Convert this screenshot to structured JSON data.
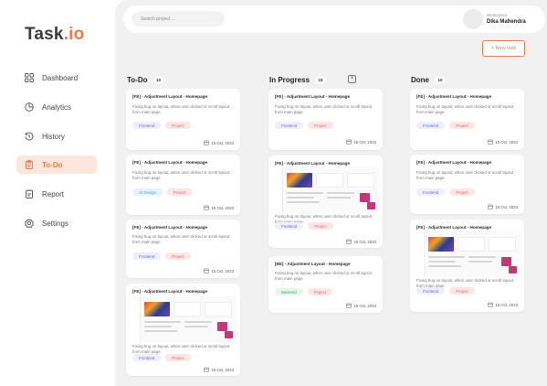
{
  "app": {
    "logo_main": "Task",
    "logo_accent": ".io"
  },
  "sidebar": {
    "items": [
      {
        "label": "Dashboard",
        "icon": "grid-icon",
        "active": false
      },
      {
        "label": "Analytics",
        "icon": "pie-chart-icon",
        "active": false
      },
      {
        "label": "History",
        "icon": "history-icon",
        "active": false
      },
      {
        "label": "To-Do",
        "icon": "clipboard-icon",
        "active": true
      },
      {
        "label": "Report",
        "icon": "report-icon",
        "active": false
      },
      {
        "label": "Settings",
        "icon": "gear-icon",
        "active": false
      }
    ]
  },
  "header": {
    "search_placeholder": "Search project ...",
    "workspace_label": "Workspace",
    "user_name": "Dika Mahendra",
    "new_task_label": "+ New task"
  },
  "colors": {
    "accent": "#f07a4a",
    "background": "#f1f1f1"
  },
  "board": {
    "columns": [
      {
        "title": "To-Do",
        "count": "10",
        "cards": [
          {
            "title": "[FE] - Adjustment Layout - Homepage",
            "desc": "Fixing bug on layout, when user clicked or scroll layout from main page.",
            "tags": [
              "Frontend",
              "Project"
            ],
            "date": "15 Oct, 2023"
          },
          {
            "title": "[FE] - Adjustment Layout - Homepage",
            "desc": "Fixing bug on layout, when user clicked or scroll layout from main page.",
            "tags": [
              "UI Design",
              "Project"
            ],
            "date": "15 Oct, 2023"
          },
          {
            "title": "[FE] - Adjustment Layout - Homepage",
            "desc": "Fixing bug on layout, when user clicked or scroll layout from main page.",
            "tags": [
              "Frontend",
              "Project"
            ],
            "date": "15 Oct, 2023"
          },
          {
            "title": "[FE] - Adjustment Layout - Homepage",
            "desc": "Fixing bug on layout, when user clicked or scroll layout from main page.",
            "tags": [
              "Frontend",
              "Project"
            ],
            "date": "15 Oct, 2023"
          }
        ]
      },
      {
        "title": "In Progress",
        "count": "15",
        "cards": [
          {
            "title": "[FE] - Adjustment Layout - Homepage",
            "desc": "Fixing bug on layout, when user clicked or scroll layout from main page.",
            "tags": [
              "Frontend",
              "Project"
            ],
            "date": "15 Oct, 2023"
          },
          {
            "title": "[FE] - Adjustment Layout - Homepage",
            "desc": "Fixing bug on layout, when user clicked or scroll layout from main page.",
            "tags": [
              "Frontend",
              "Project"
            ],
            "date": "15 Oct, 2023"
          },
          {
            "title": "[BE] - Adjustment Layout - Homepage",
            "desc": "Fixing bug on layout, when user clicked or scroll layout from main page.",
            "tags": [
              "Backend",
              "Project"
            ],
            "date": "15 Oct, 2023"
          }
        ]
      },
      {
        "title": "Done",
        "count": "10",
        "cards": [
          {
            "title": "[FE] - Adjustment Layout - Homepage",
            "desc": "Fixing bug on layout, when user clicked or scroll layout from main page.",
            "tags": [
              "Frontend",
              "Project"
            ],
            "date": "15 Oct, 2023"
          },
          {
            "title": "[FE] - Adjustment Layout - Homepage",
            "desc": "Fixing bug on layout, when user clicked or scroll layout from main page.",
            "tags": [
              "Frontend",
              "Project"
            ],
            "date": "15 Oct, 2023"
          },
          {
            "title": "[FE] - Adjustment Layout - Homepage",
            "desc": "Fixing bug on layout, when user clicked or scroll layout from main page.",
            "tags": [
              "Frontend",
              "Project"
            ],
            "date": "15 Oct, 2023"
          }
        ]
      }
    ]
  }
}
